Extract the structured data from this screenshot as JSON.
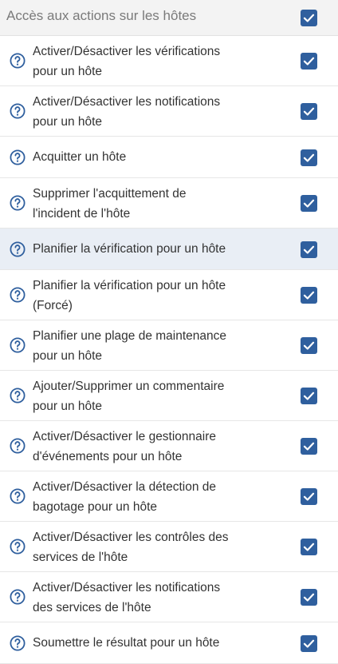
{
  "header": {
    "title": "Accès aux actions sur les hôtes",
    "checked": true
  },
  "colors": {
    "accent": "#2f5f9e",
    "highlight_row": "#e9eef5",
    "header_bg": "#f3f3f3"
  },
  "icons": {
    "help": "question-circle-icon",
    "checkbox": "checkmark-icon"
  },
  "rows": [
    {
      "line1": "Activer/Désactiver les vérifications",
      "line2": "pour un hôte",
      "checked": true
    },
    {
      "line1": "Activer/Désactiver les notifications",
      "line2": "pour un hôte",
      "checked": true
    },
    {
      "line1": "Acquitter un hôte",
      "line2": "",
      "checked": true
    },
    {
      "line1": "Supprimer l'acquittement de",
      "line2": "l'incident de l'hôte",
      "checked": true
    },
    {
      "line1": "Planifier la vérification pour un hôte",
      "line2": "",
      "checked": true
    },
    {
      "line1": "Planifier la vérification pour un hôte",
      "line2": "(Forcé)",
      "checked": true
    },
    {
      "line1": "Planifier une plage de maintenance",
      "line2": "pour un hôte",
      "checked": true
    },
    {
      "line1": "Ajouter/Supprimer un commentaire",
      "line2": "pour un hôte",
      "checked": true
    },
    {
      "line1": "Activer/Désactiver le gestionnaire",
      "line2": "d'événements pour un hôte",
      "checked": true
    },
    {
      "line1": "Activer/Désactiver la détection de",
      "line2": "bagotage pour un hôte",
      "checked": true
    },
    {
      "line1": "Activer/Désactiver les contrôles des",
      "line2": "services de l'hôte",
      "checked": true
    },
    {
      "line1": "Activer/Désactiver les notifications",
      "line2": "des services de l'hôte",
      "checked": true
    },
    {
      "line1": "Soumettre le résultat pour un hôte",
      "line2": "",
      "checked": true
    }
  ]
}
